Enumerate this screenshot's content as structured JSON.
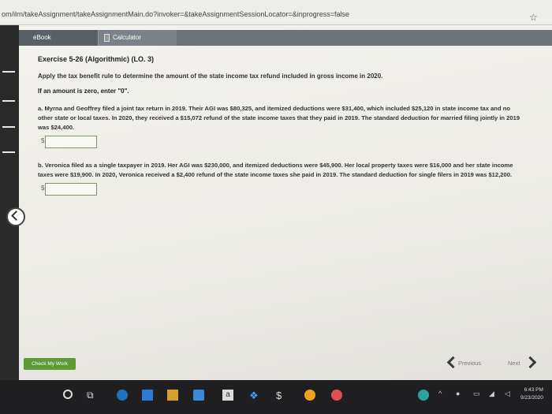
{
  "browser": {
    "url": "om/ilrn/takeAssignment/takeAssignmentMain.do?invoker=&takeAssignmentSessionLocator=&inprogress=false",
    "bookmark_icon": "star-icon"
  },
  "toolbar": {
    "ebook_label": "eBook",
    "calculator_label": "Calculator"
  },
  "exercise": {
    "title": "Exercise 5-26 (Algorithmic) (LO. 3)",
    "instruction": "Apply the tax benefit rule to determine the amount of the state income tax refund included in gross income in 2020.",
    "zero_note": "If an amount is zero, enter \"0\".",
    "part_a": "a. Myrna and Geoffrey filed a joint tax return in 2019. Their AGI was $80,325, and itemized deductions were $31,400, which included $25,120 in state income tax and no other state or local taxes. In 2020, they received a $15,072 refund of the state income taxes that they paid in 2019. The standard deduction for married filing jointly in 2019 was $24,400.",
    "part_b": "b. Veronica filed as a single taxpayer in 2019. Her AGI was $230,000, and itemized deductions were $45,900. Her local property taxes were $16,000 and her state income taxes were $19,900. In 2020, Veronica received a $2,400 refund of the state income taxes she paid in 2019. The standard deduction for single filers in 2019 was $12,200.",
    "currency_symbol": "$",
    "answer_a": "",
    "answer_b": ""
  },
  "footer": {
    "check_label": "Check My Work",
    "previous_label": "Previous",
    "next_label": "Next"
  },
  "taskbar": {
    "time": "6:43 PM",
    "date": "9/23/2020",
    "store_letter": "a"
  }
}
